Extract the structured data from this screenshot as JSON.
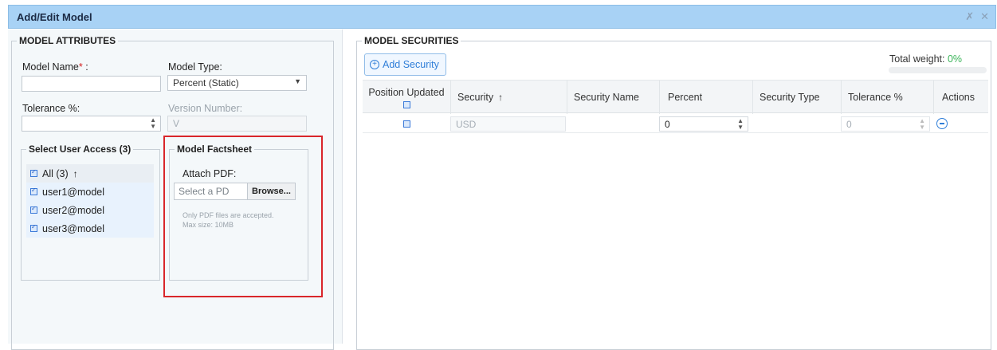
{
  "window": {
    "title": "Add/Edit Model",
    "pin_icon": "pin-icon",
    "close_icon": "close-icon"
  },
  "attributes": {
    "legend": "MODEL ATTRIBUTES",
    "model_name_label": "Model Name",
    "required_marker": "*",
    "label_colon": " :",
    "model_name_value": "",
    "model_type_label": "Model Type:",
    "model_type_value": "Percent (Static)",
    "tolerance_label": "Tolerance %:",
    "tolerance_value": "",
    "version_label": "Version Number:",
    "version_value": "V"
  },
  "user_access": {
    "legend": "Select User Access (3)",
    "all_label": "All (3)",
    "sort_arrow": "↑",
    "users": [
      "user1@model",
      "user2@model",
      "user3@model"
    ]
  },
  "factsheet": {
    "legend": "Model Factsheet",
    "attach_label": "Attach PDF:",
    "file_placeholder": "Select a PD",
    "browse_label": "Browse...",
    "hint_line1": "Only PDF files are accepted.",
    "hint_line2": "Max size: 10MB"
  },
  "securities": {
    "legend": "MODEL SECURITIES",
    "add_button": "Add Security",
    "total_weight_label": "Total weight:",
    "total_weight_value": "0%",
    "total_weight_fraction": 0,
    "columns": [
      "Position Updated",
      "Security",
      "Security Name",
      "Percent",
      "Security Type",
      "Tolerance %",
      "Actions"
    ],
    "sort_arrow": "↑",
    "rows": [
      {
        "position_updated": false,
        "security": "USD",
        "security_name": "",
        "percent": "0",
        "security_type": "",
        "tolerance": "0"
      }
    ]
  },
  "colors": {
    "titlebar": "#a8d2f5",
    "accent": "#2f7ed8",
    "highlight": "#d9262a",
    "success": "#3cb55a"
  }
}
